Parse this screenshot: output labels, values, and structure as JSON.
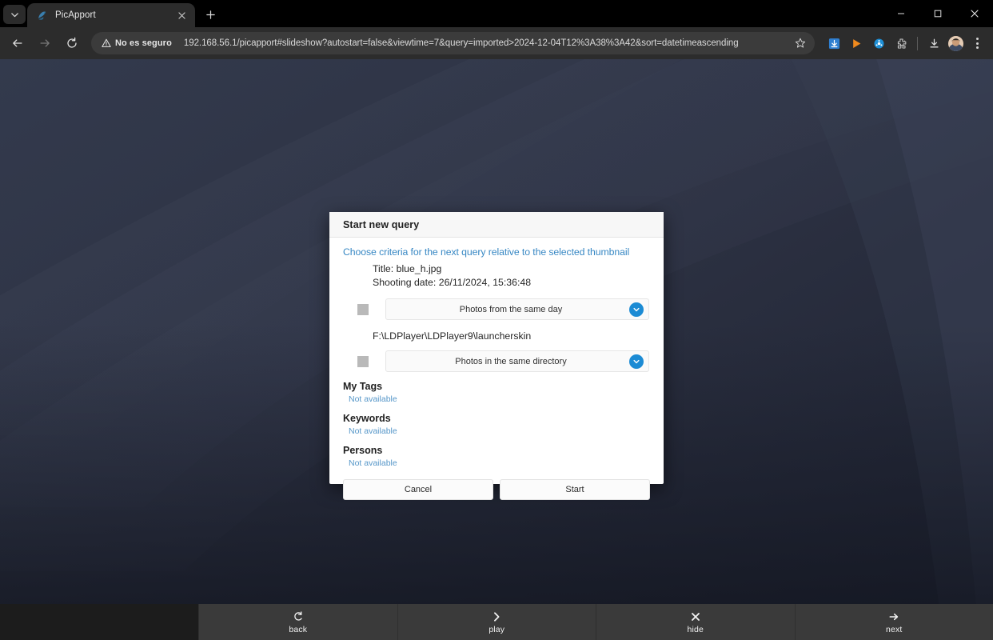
{
  "browser": {
    "tab": {
      "title": "PicApport",
      "favicon_name": "picapport-favicon"
    },
    "new_tab_label": "+",
    "window_controls": {
      "minimize": "–",
      "maximize": "□",
      "close": "×"
    },
    "nav": {
      "back": "←",
      "forward": "→",
      "reload": "↻"
    },
    "security": {
      "label": "No es seguro",
      "icon": "warning-triangle-icon"
    },
    "url": "192.168.56.1/picapport#slideshow?autostart=false&viewtime=7&query=imported>2024-12-04T12%3A38%3A42&sort=datetimeascending",
    "extensions": [
      {
        "name": "download-manager-extension-icon",
        "color": "#2f7fd0"
      },
      {
        "name": "media-player-extension-icon",
        "color": "#f08a1e"
      },
      {
        "name": "disc-extension-icon",
        "color": "#1d8fd6"
      },
      {
        "name": "puzzle-extensions-icon",
        "color": "#d6d6d6"
      }
    ],
    "downloads_label": "downloads-icon",
    "profile_label": "profile-avatar",
    "menu_label": "chrome-menu-icon"
  },
  "dialog": {
    "title": "Start new query",
    "lead": "Choose criteria for the next query relative to the selected thumbnail",
    "meta": {
      "title_line": "Title: blue_h.jpg",
      "date_line": "Shooting date: 26/11/2024, 15:36:48"
    },
    "criteria": [
      {
        "checked": false,
        "option": "Photos from the same day"
      },
      {
        "checked": false,
        "option": "Photos in the same directory"
      }
    ],
    "path": "F:\\LDPlayer\\LDPlayer9\\launcherskin",
    "sections": [
      {
        "heading": "My Tags",
        "value": "Not available"
      },
      {
        "heading": "Keywords",
        "value": "Not available"
      },
      {
        "heading": "Persons",
        "value": "Not available"
      }
    ],
    "buttons": {
      "cancel": "Cancel",
      "start": "Start"
    },
    "accent_color": "#1c8bd4",
    "link_color": "#3888c4"
  },
  "controlbar": {
    "items": [
      {
        "label": "back",
        "icon": "undo-arrow-icon"
      },
      {
        "label": "play",
        "icon": "chevron-right-icon"
      },
      {
        "label": "hide",
        "icon": "close-x-icon"
      },
      {
        "label": "next",
        "icon": "arrow-right-icon"
      }
    ]
  },
  "wallpaper": {
    "base_color": "#2e3344",
    "band_colors": [
      "#363c4e",
      "#3b4154",
      "#40475b",
      "#2a2f3f"
    ]
  }
}
